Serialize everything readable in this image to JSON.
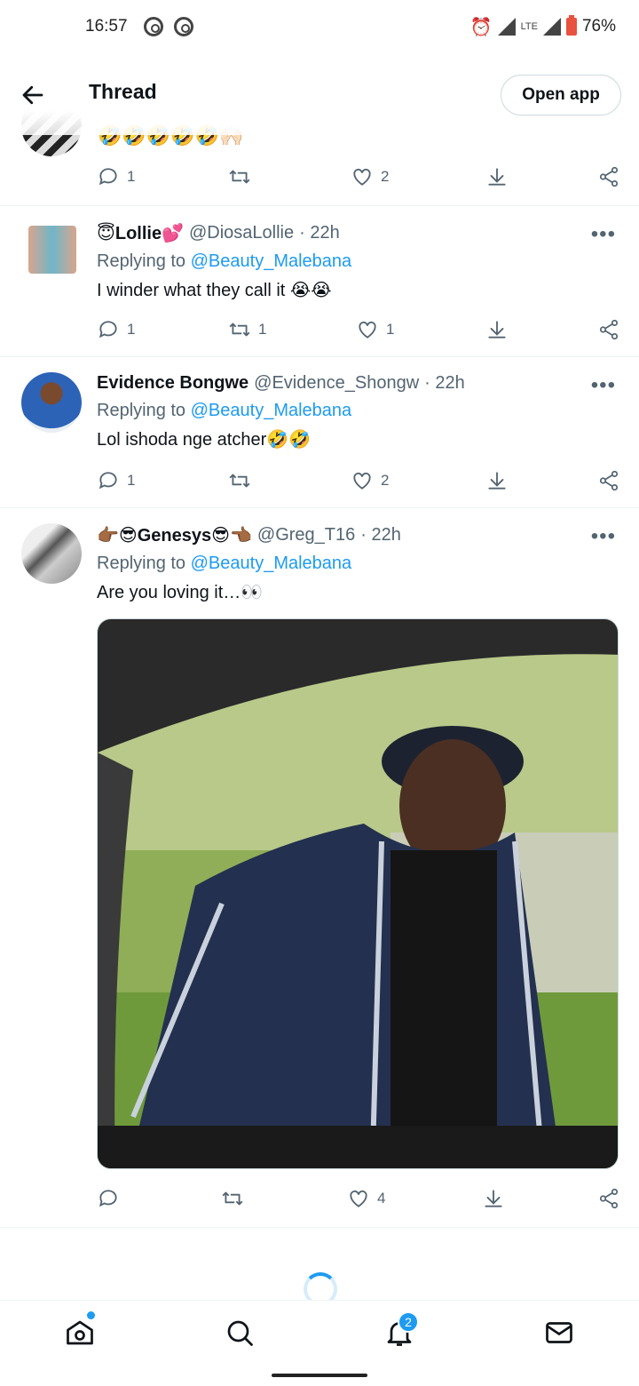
{
  "status_bar": {
    "time": "16:57",
    "battery": "76%",
    "network": "LTE"
  },
  "header": {
    "title": "Thread",
    "open_app": "Open app"
  },
  "top_tweet": {
    "emoji_text": "🤣🤣🤣🤣🤣🙌🏻",
    "reply_count": "1",
    "retweet_count": "",
    "like_count": "2"
  },
  "tweets": [
    {
      "display_name": "😇Lollie💕",
      "handle": "@DiosaLollie",
      "time": "· 22h",
      "replying_to_label": "Replying to",
      "replying_to": "@Beauty_Malebana",
      "text": "I winder what they call it 😭😭",
      "reply_count": "1",
      "retweet_count": "1",
      "like_count": "1"
    },
    {
      "display_name": "Evidence Bongwe",
      "handle": "@Evidence_Shongw",
      "time": "· 22h",
      "replying_to_label": "Replying to",
      "replying_to": "@Beauty_Malebana",
      "text": "Lol ishoda nge atcher🤣🤣",
      "reply_count": "1",
      "retweet_count": "",
      "like_count": "2"
    },
    {
      "display_name": "👉🏾😎Genesys😎👈🏾",
      "handle": "@Greg_T16",
      "time": "· 22h",
      "replying_to_label": "Replying to",
      "replying_to": "@Beauty_Malebana",
      "text": "Are you loving it…👀",
      "reply_count": "",
      "retweet_count": "",
      "like_count": "4"
    }
  ],
  "more_label": "•••",
  "bottom_nav": {
    "notifications_badge": "2"
  },
  "colors": {
    "accent": "#1d9bf0",
    "text": "#0f1419",
    "muted": "#536471"
  },
  "icons": [
    "back-arrow-icon",
    "reply-icon",
    "retweet-icon",
    "like-icon",
    "download-icon",
    "share-icon",
    "home-icon",
    "search-icon",
    "bell-icon",
    "mail-icon"
  ]
}
